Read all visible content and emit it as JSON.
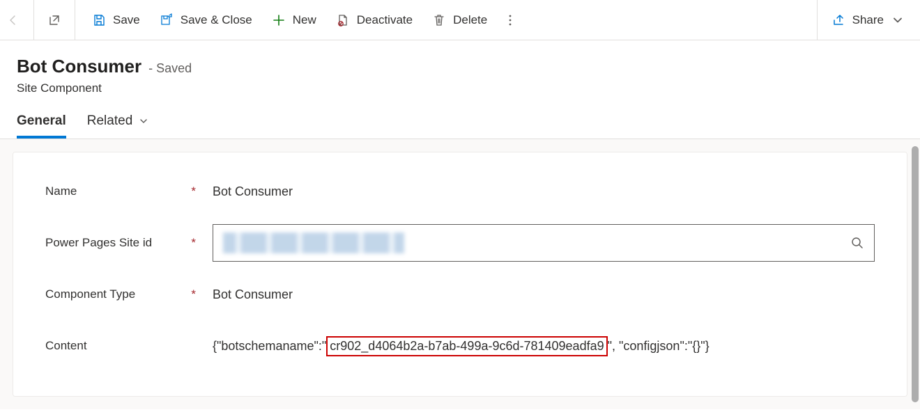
{
  "commandBar": {
    "save": "Save",
    "saveClose": "Save & Close",
    "new": "New",
    "deactivate": "Deactivate",
    "delete": "Delete",
    "share": "Share"
  },
  "header": {
    "title": "Bot Consumer",
    "savedTag": "- Saved",
    "entity": "Site Component"
  },
  "tabs": {
    "general": "General",
    "related": "Related"
  },
  "form": {
    "name": {
      "label": "Name",
      "value": "Bot Consumer",
      "required": true
    },
    "siteId": {
      "label": "Power Pages Site id",
      "required": true
    },
    "componentType": {
      "label": "Component Type",
      "value": "Bot Consumer",
      "required": true
    },
    "content": {
      "label": "Content",
      "prefix": "{\"botschemaname\":\"",
      "highlighted": "cr902_d4064b2a-b7ab-499a-9c6d-781409eadfa9",
      "suffix": "\", \"configjson\":\"{}\"}"
    }
  }
}
